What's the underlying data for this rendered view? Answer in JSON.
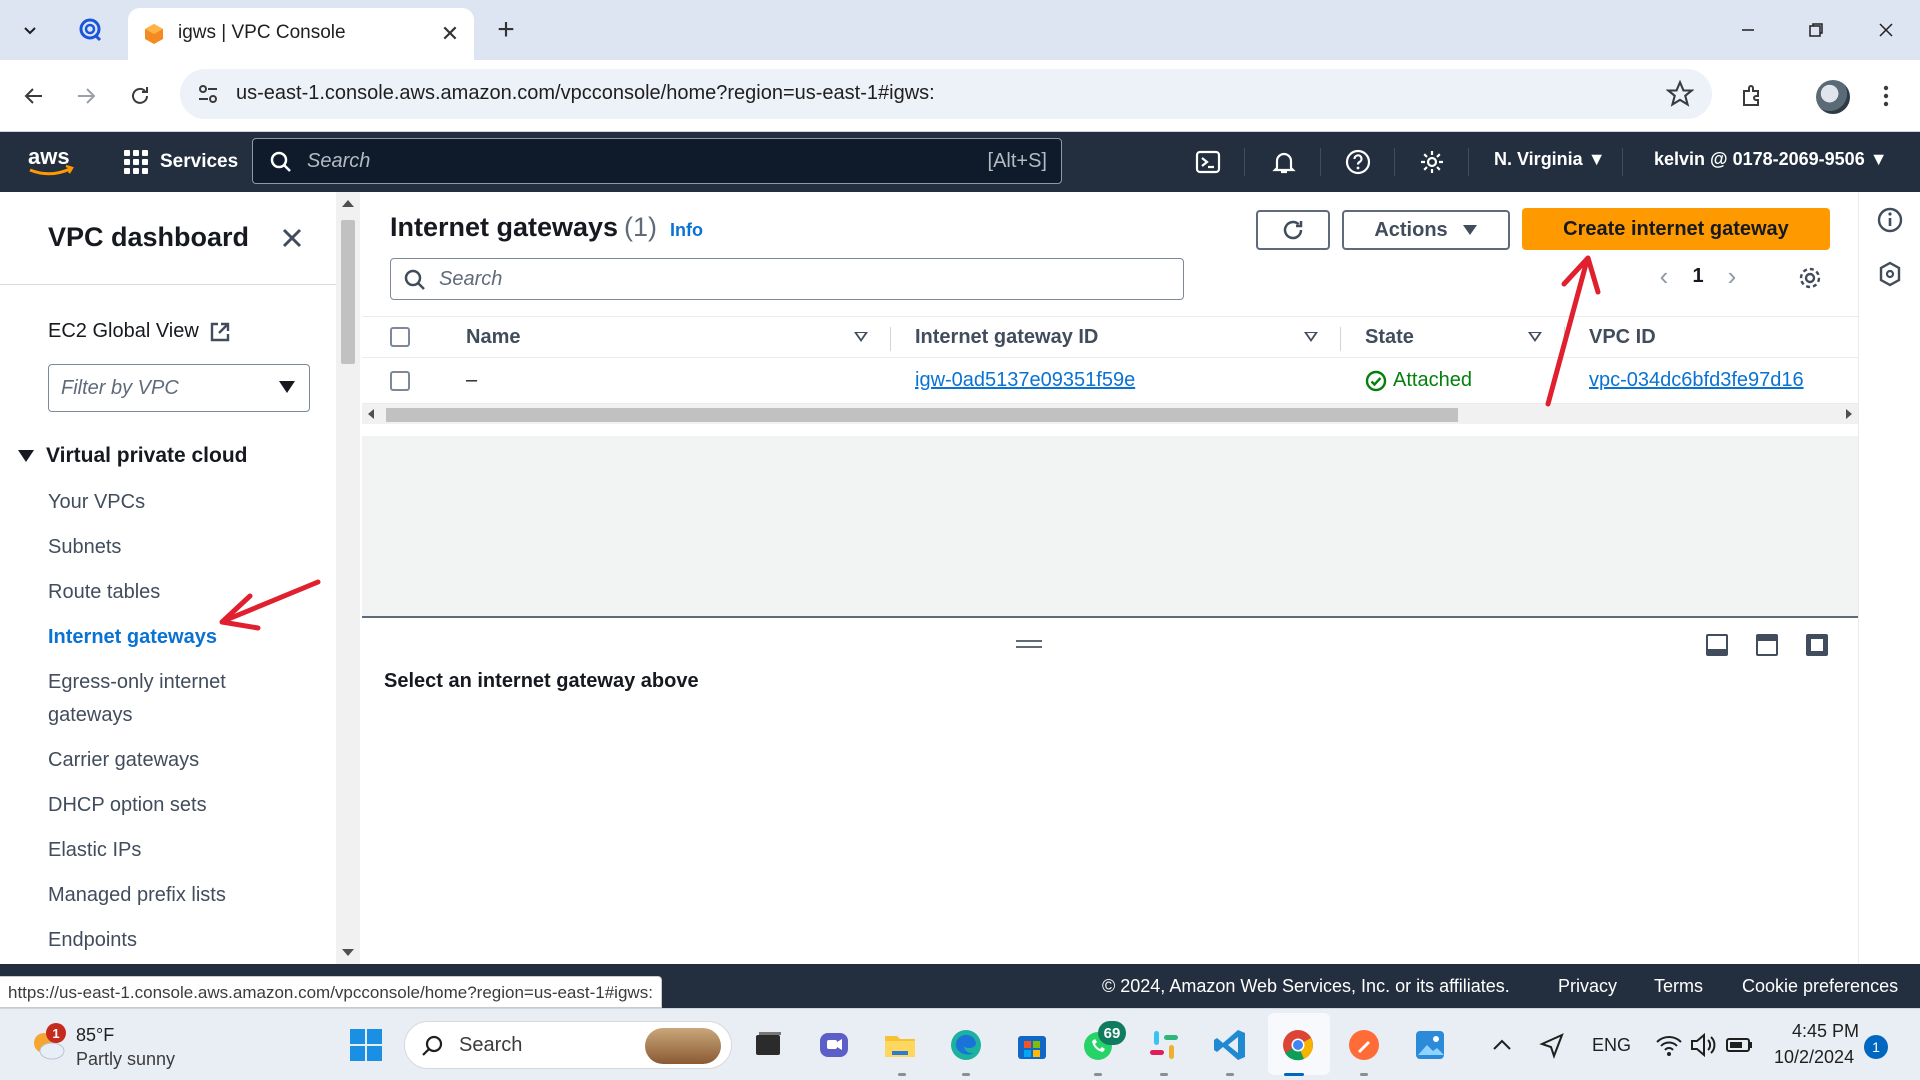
{
  "browser": {
    "tab_title": "igws | VPC Console",
    "url": "us-east-1.console.aws.amazon.com/vpcconsole/home?region=us-east-1#igws:",
    "status_url": "https://us-east-1.console.aws.amazon.com/vpcconsole/home?region=us-east-1#igws:"
  },
  "aws_nav": {
    "services_label": "Services",
    "search_placeholder": "Search",
    "search_shortcut": "[Alt+S]",
    "region": "N. Virginia ▼",
    "account": "kelvin @ 0178-2069-9506 ▼"
  },
  "sidebar": {
    "title": "VPC dashboard",
    "ec2_global": "EC2 Global View",
    "filter_placeholder": "Filter by VPC",
    "section": "Virtual private cloud",
    "items": [
      {
        "label": "Your VPCs"
      },
      {
        "label": "Subnets"
      },
      {
        "label": "Route tables"
      },
      {
        "label": "Internet gateways"
      },
      {
        "label": "Egress-only internet gateways"
      },
      {
        "label": "Carrier gateways"
      },
      {
        "label": "DHCP option sets"
      },
      {
        "label": "Elastic IPs"
      },
      {
        "label": "Managed prefix lists"
      },
      {
        "label": "Endpoints"
      }
    ]
  },
  "main": {
    "title": "Internet gateways",
    "count": "(1)",
    "info": "Info",
    "actions_label": "Actions",
    "create_label": "Create internet gateway",
    "search_placeholder": "Search",
    "page": "1",
    "columns": [
      "Name",
      "Internet gateway ID",
      "State",
      "VPC ID"
    ],
    "rows": [
      {
        "name": "–",
        "igw_id": "igw-0ad5137e09351f59e",
        "state": "Attached",
        "vpc_id": "vpc-034dc6bfd3fe97d16"
      }
    ],
    "split_message": "Select an internet gateway above"
  },
  "footer": {
    "copyright": "© 2024, Amazon Web Services, Inc. or its affiliates.",
    "privacy": "Privacy",
    "terms": "Terms",
    "cookies": "Cookie preferences"
  },
  "taskbar": {
    "weather_temp": "85°F",
    "weather_cond": "Partly sunny",
    "weather_badge": "1",
    "search_placeholder": "Search",
    "whatsapp_badge": "69",
    "lang": "ENG",
    "time": "4:45 PM",
    "date": "10/2/2024",
    "notifications": "1"
  },
  "colors": {
    "aws_nav": "#232f3e",
    "primary_button": "#ff9900",
    "link": "#0972d3",
    "success": "#037f0c",
    "annotation_arrow": "#e0202e"
  }
}
